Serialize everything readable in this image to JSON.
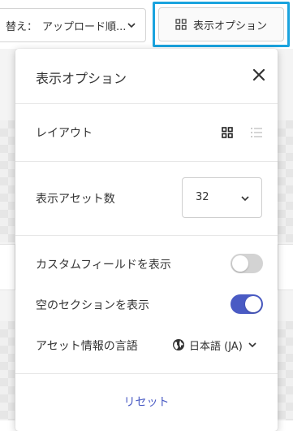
{
  "toolbar": {
    "sort_label": "替え：",
    "sort_value": "アップロード順...",
    "view_options_label": "表示オプション"
  },
  "panel": {
    "title": "表示オプション",
    "layout_label": "レイアウト",
    "asset_count_label": "表示アセット数",
    "asset_count_value": "32",
    "custom_fields_label": "カスタムフィールドを表示",
    "custom_fields_enabled": false,
    "empty_sections_label": "空のセクションを表示",
    "empty_sections_enabled": true,
    "asset_language_label": "アセット情報の言語",
    "asset_language_value": "日本語 (JA)",
    "reset_label": "リセット"
  },
  "colors": {
    "accent": "#4a5bc4",
    "highlight_outline": "#1aa3de",
    "toggle_off": "#d3d3d3"
  }
}
